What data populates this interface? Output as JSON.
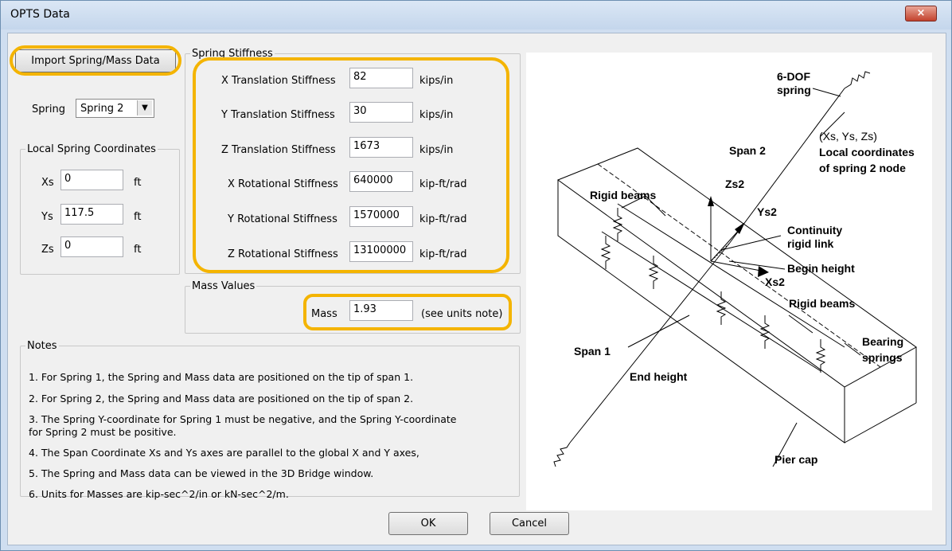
{
  "window": {
    "title": "OPTS Data",
    "close_glyph": "×"
  },
  "import_button": {
    "label": "Import Spring/Mass Data"
  },
  "spring_select": {
    "label": "Spring",
    "value": "Spring 2",
    "arrow": "▼"
  },
  "local_coords": {
    "legend": "Local Spring Coordinates",
    "rows": [
      {
        "label": "Xs",
        "value": "0",
        "unit": "ft"
      },
      {
        "label": "Ys",
        "value": "117.5",
        "unit": "ft"
      },
      {
        "label": "Zs",
        "value": "0",
        "unit": "ft"
      }
    ]
  },
  "stiffness": {
    "legend": "Spring Stiffness",
    "rows": [
      {
        "label": "X Translation Stiffness",
        "value": "82",
        "unit": "kips/in"
      },
      {
        "label": "Y Translation Stiffness",
        "value": "30",
        "unit": "kips/in"
      },
      {
        "label": "Z Translation Stiffness",
        "value": "1673",
        "unit": "kips/in"
      },
      {
        "label": "X Rotational Stiffness",
        "value": "640000",
        "unit": "kip-ft/rad"
      },
      {
        "label": "Y Rotational Stiffness",
        "value": "1570000",
        "unit": "kip-ft/rad"
      },
      {
        "label": "Z Rotational Stiffness",
        "value": "13100000",
        "unit": "kip-ft/rad"
      }
    ]
  },
  "mass": {
    "legend": "Mass Values",
    "label": "Mass",
    "value": "1.93",
    "note": "(see units note)"
  },
  "notes": {
    "legend": "Notes",
    "lines": [
      "1.  For Spring 1, the Spring and Mass data are positioned on the tip of span 1.",
      "2.  For Spring 2, the Spring and Mass data are positioned on the tip of span 2.",
      "3.  The Spring Y-coordinate for Spring 1 must be negative, and the Spring Y-coordinate",
      "for Spring 2 must be positive.",
      "4.  The Span Coordinate Xs and Ys axes are parallel to the global X and Y axes,",
      "5.  The Spring and Mass data can be viewed in the 3D Bridge window.",
      "6.  Units for Masses are kip-sec^2/in or kN-sec^2/m."
    ]
  },
  "diagram": {
    "labels": {
      "dof": "6-DOF",
      "spring": "spring",
      "coords": "(Xs, Ys, Zs)",
      "local1": "Local coordinates",
      "local2": "of spring 2 node",
      "span2": "Span 2",
      "rigid_beams_top": "Rigid beams",
      "zs2": "Zs2",
      "ys2": "Ys2",
      "continuity1": "Continuity",
      "continuity2": "rigid link",
      "begin_height": "Begin height",
      "xs2": "Xs2",
      "rigid_beams_right": "Rigid beams",
      "span1": "Span 1",
      "bearing1": "Bearing",
      "bearing2": "springs",
      "end_height": "End height",
      "pier_cap": "Pier cap"
    }
  },
  "buttons": {
    "ok": "OK",
    "cancel": "Cancel"
  },
  "colors": {
    "highlight": "#f4b400",
    "dialog_bg": "#f0f0f0",
    "frame": "#cfdef0"
  }
}
